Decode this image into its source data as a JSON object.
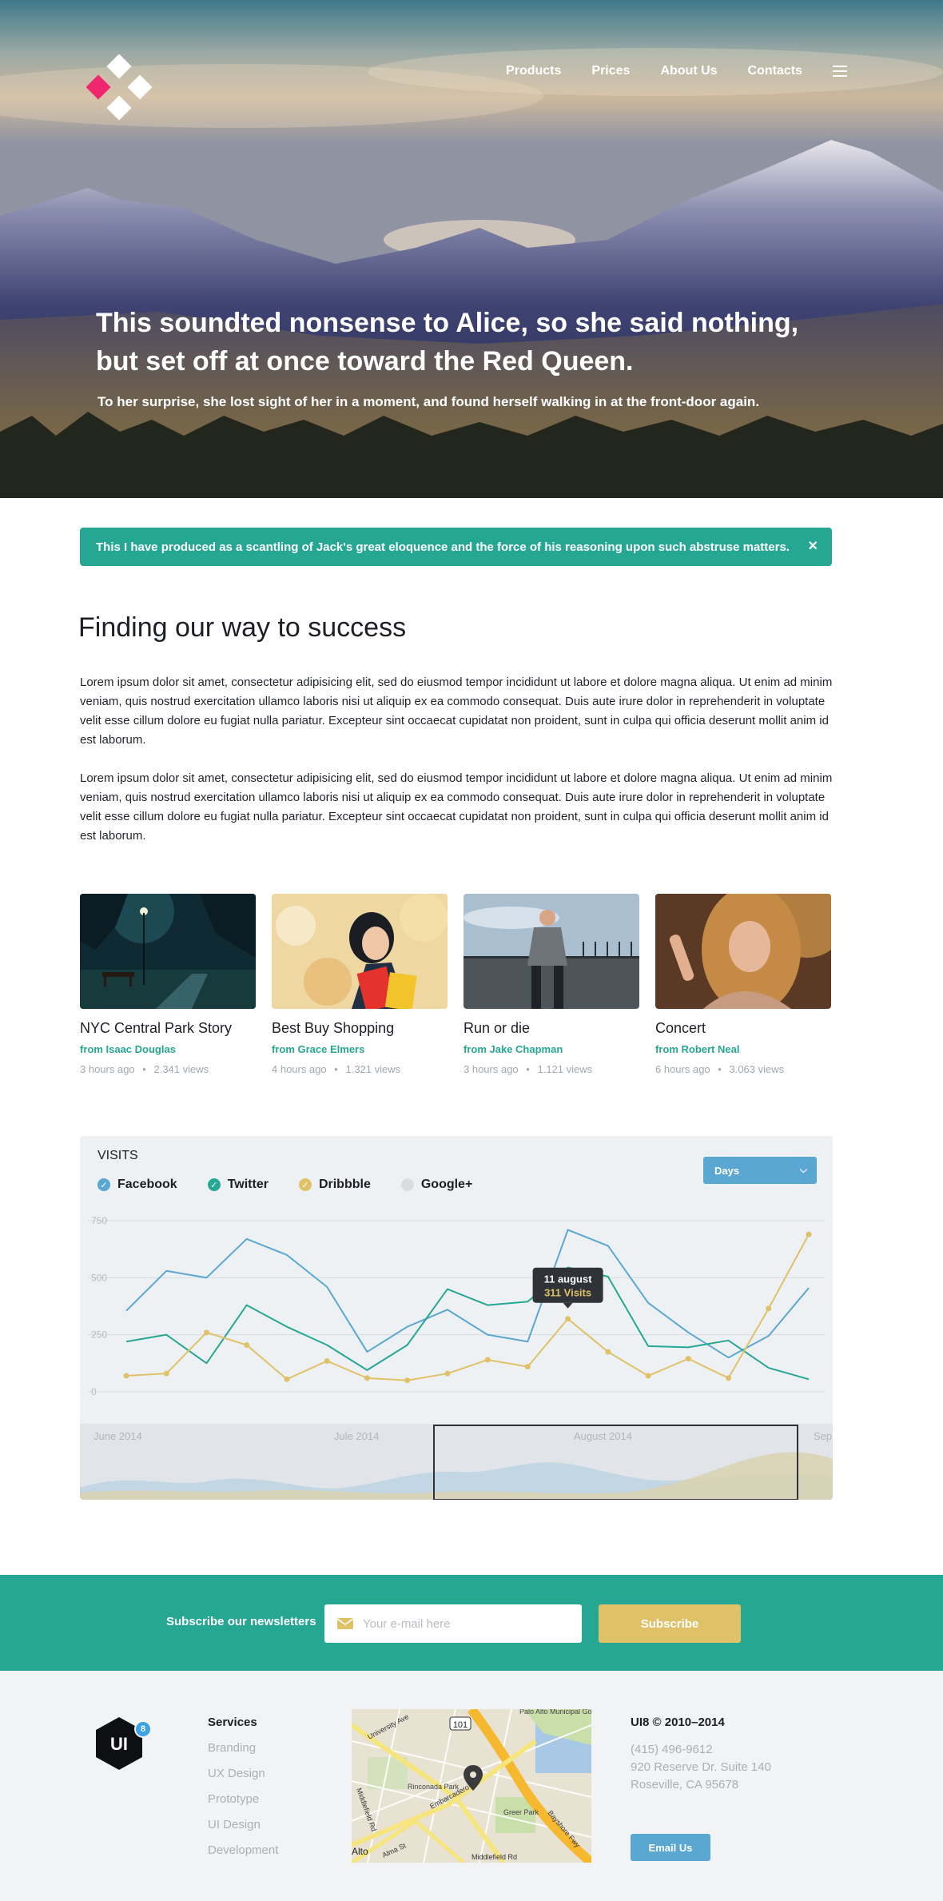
{
  "nav": {
    "items": [
      "Products",
      "Prices",
      "About Us",
      "Contacts"
    ]
  },
  "hero": {
    "headline": "This soundted nonsense to Alice, so she said nothing, but set off at once toward the Red Queen.",
    "subtitle": "To her surprise, she lost sight of her in a moment, and found herself walking in at the front-door again."
  },
  "alert": {
    "text": "This I have produced as a scantling of Jack's great eloquence and the force of his reasoning upon such abstruse matters.",
    "close": "×"
  },
  "article": {
    "title": "Finding our way to success",
    "paragraphs": [
      "Lorem ipsum dolor sit amet, consectetur adipisicing elit, sed do eiusmod tempor incididunt ut labore et dolore magna aliqua. Ut enim ad minim veniam, quis nostrud exercitation ullamco laboris nisi ut aliquip ex ea commodo consequat. Duis aute irure dolor in reprehenderit in voluptate velit esse cillum dolore eu fugiat nulla pariatur. Excepteur sint occaecat cupidatat non proident, sunt in culpa qui officia deserunt mollit anim id est laborum.",
      "Lorem ipsum dolor sit amet, consectetur adipisicing elit, sed do eiusmod tempor incididunt ut labore et dolore magna aliqua. Ut enim ad minim veniam, quis nostrud exercitation ullamco laboris nisi ut aliquip ex ea commodo consequat. Duis aute irure dolor in reprehenderit in voluptate velit esse cillum dolore eu fugiat nulla pariatur. Excepteur sint occaecat cupidatat non proident, sunt in culpa qui officia deserunt mollit anim id est laborum."
    ]
  },
  "cards": [
    {
      "title": "NYC Central Park Story",
      "author": "from Isaac Douglas",
      "time": "3 hours ago",
      "views": "2.341 views"
    },
    {
      "title": "Best Buy Shopping",
      "author": "from Grace Elmers",
      "time": "4 hours ago",
      "views": "1.321 views"
    },
    {
      "title": "Run or die",
      "author": "from Jake Chapman",
      "time": "3 hours ago",
      "views": "1.121 views"
    },
    {
      "title": "Concert",
      "author": "from Robert Neal",
      "time": "6 hours ago",
      "views": "3.063 views"
    }
  ],
  "card_separator": "•",
  "chart": {
    "title": "VISITS",
    "legend": [
      {
        "label": "Facebook",
        "checked": true,
        "color": "#5aa7d2"
      },
      {
        "label": "Twitter",
        "checked": true,
        "color": "#26a793"
      },
      {
        "label": "Dribbble",
        "checked": true,
        "color": "#dfc168"
      },
      {
        "label": "Google+",
        "checked": false,
        "color": "#d9dde1"
      }
    ],
    "select_value": "Days",
    "tooltip": {
      "date": "11 august",
      "value": "311 Visits"
    },
    "range_labels": [
      "June 2014",
      "Jule 2014",
      "August 2014",
      "Sep"
    ]
  },
  "chart_data": {
    "type": "line",
    "title": "VISITS",
    "ylim": [
      0,
      750
    ],
    "yticks": [
      0,
      250,
      500,
      750
    ],
    "grid": true,
    "legend_position": "top-left",
    "series": [
      {
        "name": "Facebook",
        "color": "#5aa7d2",
        "values": [
          355,
          530,
          500,
          670,
          600,
          460,
          175,
          285,
          360,
          250,
          220,
          710,
          640,
          390,
          260,
          150,
          245,
          455
        ]
      },
      {
        "name": "Twitter",
        "color": "#26a793",
        "values": [
          220,
          250,
          125,
          380,
          285,
          205,
          95,
          205,
          450,
          380,
          395,
          545,
          505,
          200,
          195,
          225,
          105,
          55
        ]
      },
      {
        "name": "Dribbble",
        "color": "#dfc168",
        "values": [
          70,
          80,
          260,
          205,
          55,
          135,
          60,
          50,
          80,
          140,
          110,
          320,
          175,
          70,
          145,
          60,
          365,
          690
        ]
      }
    ],
    "highlight": {
      "series": "Dribbble",
      "index": 11,
      "label": "11 august",
      "value": 311
    }
  },
  "newsletter": {
    "label": "Subscribe our newsletters",
    "placeholder": "Your e-mail here",
    "button": "Subscribe"
  },
  "footer": {
    "logo_text": "UI",
    "badge": "8",
    "services_title": "Services",
    "services": [
      "Branding",
      "UX Design",
      "Prototype",
      "UI Design",
      "Development"
    ],
    "map_labels": [
      "Palo Alto Municipal Golf Course",
      "101",
      "University Ave",
      "Embarcadero Rd",
      "Middlefield Rd",
      "Rinconada Park",
      "Greer Park",
      "Bayshore Fwy",
      "Alto",
      "Alma St",
      "Middlefield Rd"
    ],
    "copyright": "UI8 © 2010–2014",
    "phone": "(415) 496-9612",
    "address1": "920 Reserve Dr. Suite 140",
    "address2": "Roseville, CA 95678",
    "email_button": "Email Us"
  }
}
